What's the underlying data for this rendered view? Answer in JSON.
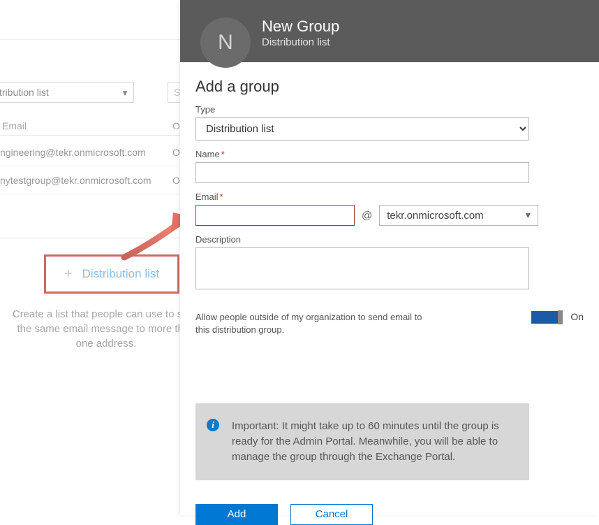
{
  "back": {
    "filter_value": "tribution list",
    "search_placeholder": "Se",
    "col_email": "Email",
    "col_owner": "O",
    "rows": [
      {
        "email": "ngineering@tekr.onmicrosoft.com",
        "owner": "O"
      },
      {
        "email": "nytestgroup@tekr.onmicrosoft.com",
        "owner": "O"
      }
    ],
    "dist_button_label": "Distribution list",
    "caption": "Create a list that people can use to send the same email message to more than one address."
  },
  "header": {
    "avatar_letter": "N",
    "title": "New Group",
    "subtitle": "Distribution list"
  },
  "form": {
    "title": "Add a group",
    "type_label": "Type",
    "type_value": "Distribution list",
    "name_label": "Name",
    "email_label": "Email",
    "at": "@",
    "domain": "tekr.onmicrosoft.com",
    "description_label": "Description",
    "allow_external_text": "Allow people outside of my organization to send email to this distribution group.",
    "toggle_state": "On",
    "info_text": "Important: It might take up to 60 minutes until the group is ready for the Admin Portal. Meanwhile, you will be able to manage the group through the Exchange Portal.",
    "add_label": "Add",
    "cancel_label": "Cancel"
  }
}
